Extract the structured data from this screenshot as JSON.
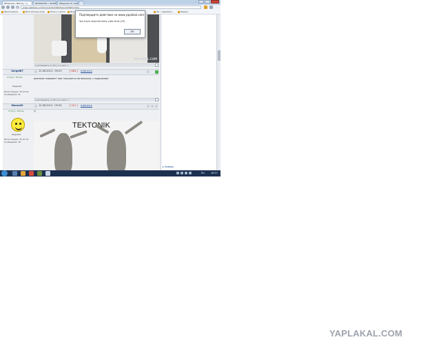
{
  "browser": {
    "tabs": [
      {
        "label": "ЯПлакалъ, Mazury • y",
        "active": true
      },
      {
        "label": "ЯПЛАКАЛЪ • ЗАЛИ",
        "active": false
      },
      {
        "label": "Общение по тем",
        "active": false
      },
      {
        "label": "",
        "active": false
      }
    ],
    "address": "www.yaplakal.com/forum/2/st/1950/topic/476953.html",
    "bookmarks": [
      "Приложения",
      "Бесплатные игры",
      "Поиск ссылок",
      "Вконтакте",
      "Вконтакте",
      "Почта",
      "VK • Сделай в...",
      "Яндекс"
    ]
  },
  "post1": {
    "toolbar": "[ цитировать ] [ ЛС ] [ в закл. ]",
    "photo_watermark": "YAPLAKAL.COM"
  },
  "post2": {
    "username": "Sergei87",
    "date": "12.06.2014 · 09:23",
    "rating": "[ 604 ]",
    "reply_link": "ответить",
    "status": "Статус: Online",
    "rank": "Ыдущий",
    "joined": "Регистрация: 25.03.10",
    "messages": "Сообщений: 91",
    "text": "реально плакают! кое тоскуются на воскоси, с подсказки!",
    "toolbar": "[ цитировать ] [ ЛС ] [ в закл. ]"
  },
  "post3": {
    "username": "Marsa20",
    "date": "12.06.2014 · 09:34",
    "rating": "[ 211 ]",
    "reply_link": "ответить",
    "status": "Статус: Online",
    "rank": "Ыдущий",
    "joined": "Регистрация: 01.07.13",
    "messages": "Сообщений: 18",
    "text": "))",
    "image_caption": "TEKTONIK"
  },
  "sidebar": {
    "more_link": "▸ Наверх"
  },
  "dialog": {
    "title": "Подтвердите действие на www.yaplakal.com",
    "message": "You have reached daily vote limit (20)",
    "ok_label": "OK"
  },
  "taskbar": {
    "lang": "RU",
    "clock": "18:57"
  },
  "watermark": "YAPLAKAL.COM"
}
